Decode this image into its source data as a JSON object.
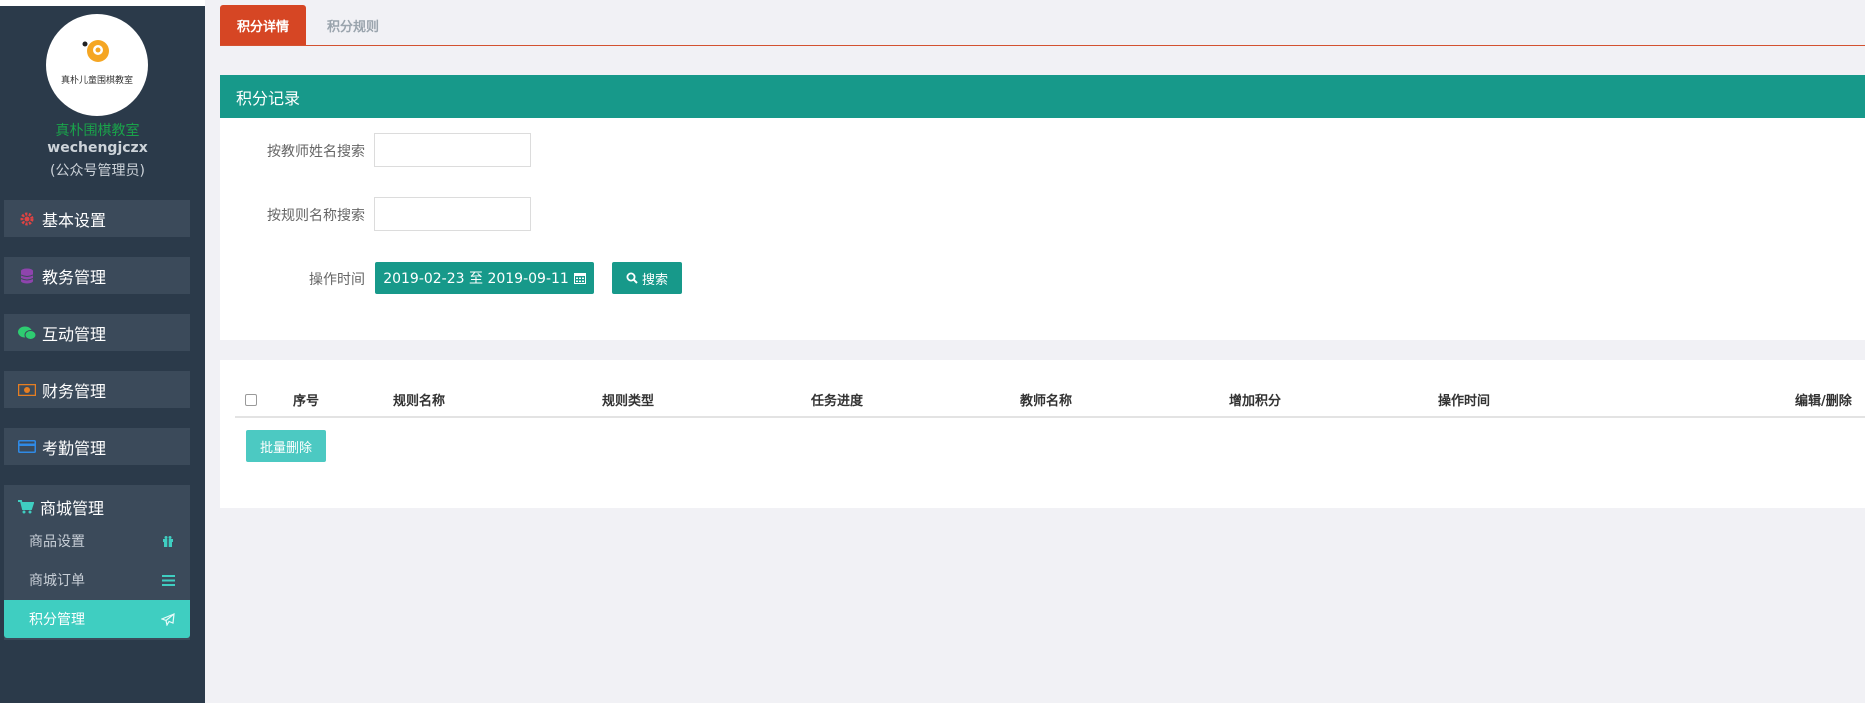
{
  "sidebar": {
    "logo_text": "真朴儿童围棋教室",
    "school_name": "真朴围棋教室",
    "username": "wechengjczx",
    "role": "(公众号管理员)",
    "items": [
      {
        "label": "基本设置",
        "icon": "gear-icon",
        "color": "#e04343"
      },
      {
        "label": "教务管理",
        "icon": "database-icon",
        "color": "#8e44ad"
      },
      {
        "label": "互动管理",
        "icon": "wechat-icon",
        "color": "#2ecc71"
      },
      {
        "label": "财务管理",
        "icon": "money-icon",
        "color": "#e67e22"
      },
      {
        "label": "考勤管理",
        "icon": "credit-card-icon",
        "color": "#2f8ae5"
      }
    ],
    "shop": {
      "label": "商城管理",
      "icon": "shopping-cart-icon",
      "sub_items": [
        {
          "label": "商品设置",
          "icon": "gift-icon"
        },
        {
          "label": "商城订单",
          "icon": "list-icon"
        },
        {
          "label": "积分管理",
          "icon": "paper-plane-icon",
          "active": true
        }
      ]
    }
  },
  "tabs": [
    {
      "label": "积分详情",
      "active": true
    },
    {
      "label": "积分规则",
      "active": false
    }
  ],
  "panel": {
    "title": "积分记录",
    "teacher_search_label": "按教师姓名搜索",
    "teacher_search_value": "",
    "rule_search_label": "按规则名称搜索",
    "rule_search_value": "",
    "time_label": "操作时间",
    "date_range": "2019-02-23 至 2019-09-11",
    "search_button": "搜索"
  },
  "table": {
    "columns": [
      "序号",
      "规则名称",
      "规则类型",
      "任务进度",
      "教师名称",
      "增加积分",
      "操作时间",
      "编辑/删除"
    ],
    "rows": [],
    "batch_delete": "批量删除"
  },
  "colors": {
    "sidebar_bg": "#2b3a4a",
    "accent_teal": "#17998a",
    "active_tab": "#d64624",
    "active_sub": "#3fcec1"
  }
}
